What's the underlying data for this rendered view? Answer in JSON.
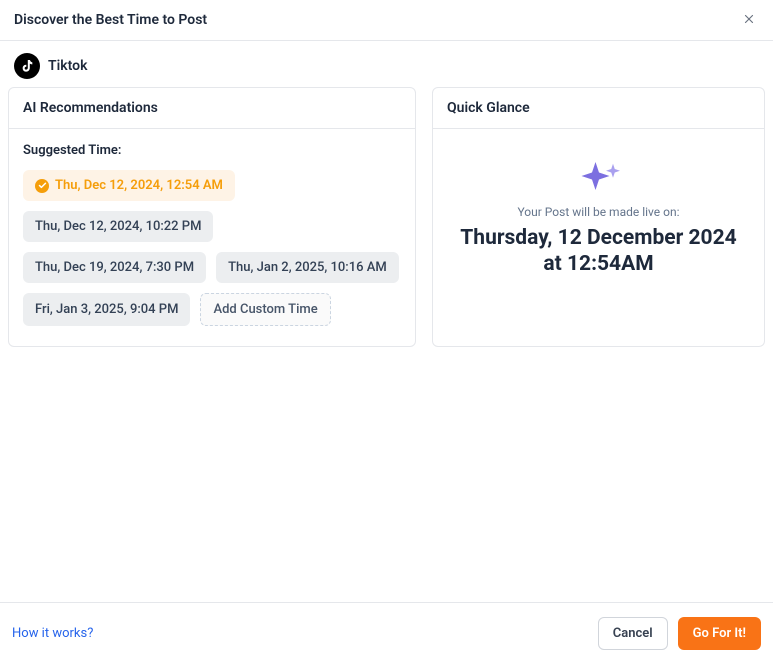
{
  "header": {
    "title": "Discover the Best Time to Post"
  },
  "platform": {
    "name": "Tiktok"
  },
  "recommendations": {
    "title": "AI Recommendations",
    "suggested_label": "Suggested Time:",
    "times": [
      "Thu, Dec 12, 2024, 12:54 AM",
      "Thu, Dec 12, 2024, 10:22 PM",
      "Thu, Dec 19, 2024, 7:30 PM",
      "Thu, Jan 2, 2025, 10:16 AM",
      "Fri, Jan 3, 2025, 9:04 PM"
    ],
    "custom_label": "Add Custom Time"
  },
  "glance": {
    "title": "Quick Glance",
    "sub": "Your Post will be made live on:",
    "main_line1": "Thursday, 12 December 2024",
    "main_line2": "at 12:54AM"
  },
  "footer": {
    "how_link": "How it works?",
    "cancel": "Cancel",
    "go": "Go For It!"
  }
}
